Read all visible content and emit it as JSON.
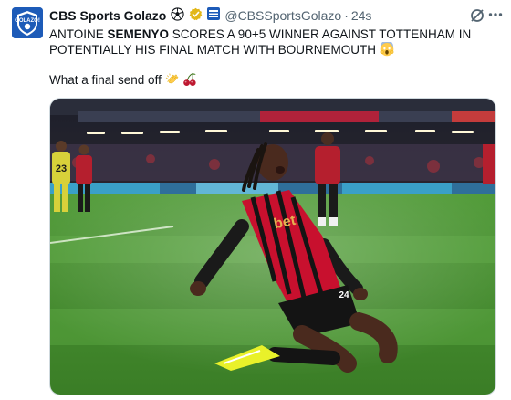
{
  "author": {
    "name": "CBS Sports Golazo",
    "handle": "@CBSSportsGolazo",
    "separator": "·",
    "time": "24s",
    "avatar_text": "GOLAZO!"
  },
  "tweet": {
    "text_part1": "ANTOINE ",
    "text_bold": "SEMENYO",
    "text_part2": " SCORES A 90+5 WINNER AGAINST TOTTENHAM IN POTENTIALLY HIS FINAL MATCH WITH BOURNEMOUTH",
    "line2_text": "What a final send off"
  },
  "media": {
    "shirt_number": "24",
    "sponsor_text": "bet",
    "player_a_number": "23"
  },
  "icons": {
    "soccer_ball": "soccer-ball-icon",
    "verified": "gold-verified-icon",
    "affiliate": "affiliate-badge-icon",
    "grok": "grok-icon",
    "more": "more-icon",
    "scream": "scream-emoji",
    "clap": "clap-emoji",
    "cherries": "cherries-emoji"
  },
  "colors": {
    "verified_gold": "#e2b719",
    "avatar_blue": "#1d5bb8",
    "text_secondary": "#536471",
    "pitch_green": "#3f8a2c",
    "kit_red": "#c8102e"
  }
}
